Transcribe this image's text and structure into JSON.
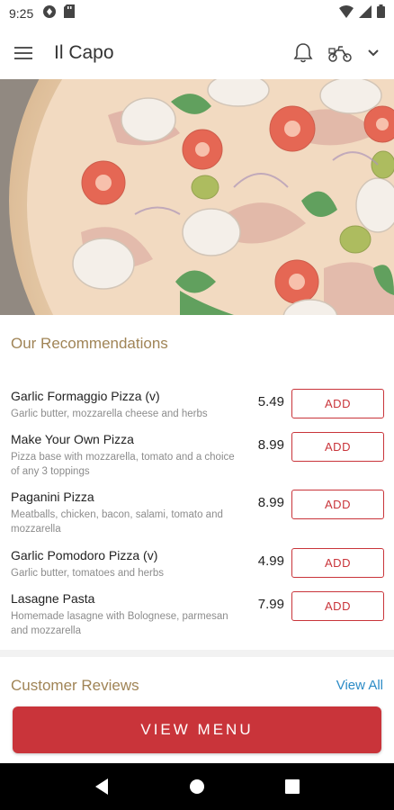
{
  "status_bar": {
    "time": "9:25",
    "left_icons": [
      "notification-app-icon",
      "sd-card-icon"
    ],
    "right_icons": [
      "wifi-icon",
      "signal-icon",
      "battery-icon"
    ]
  },
  "app_bar": {
    "title": "Il Capo",
    "icons": [
      "menu-icon",
      "bell-icon",
      "delivery-icon",
      "chevron-down-icon"
    ]
  },
  "recommendations": {
    "title": "Our Recommendations",
    "items": [
      {
        "name": "Garlic Formaggio Pizza (v)",
        "description": "Garlic butter, mozzarella cheese and herbs",
        "price": "5.49",
        "button": "ADD"
      },
      {
        "name": "Make Your Own Pizza",
        "description": "Pizza base with mozzarella, tomato and a choice of any 3 toppings",
        "price": "8.99",
        "button": "ADD"
      },
      {
        "name": "Paganini Pizza",
        "description": "Meatballs, chicken, bacon, salami, tomato and mozzarella",
        "price": "8.99",
        "button": "ADD"
      },
      {
        "name": "Garlic Pomodoro Pizza (v)",
        "description": "Garlic butter, tomatoes and herbs",
        "price": "4.99",
        "button": "ADD"
      },
      {
        "name": "Lasagne Pasta",
        "description": "Homemade lasagne with Bolognese, parmesan and mozzarella",
        "price": "7.99",
        "button": "ADD"
      }
    ]
  },
  "reviews": {
    "title": "Customer Reviews",
    "view_all": "View All"
  },
  "cta": {
    "label": "VIEW MENU"
  },
  "colors": {
    "accent_red": "#c9343a",
    "section_gold": "#a08456",
    "link_blue": "#2b8bc6"
  }
}
